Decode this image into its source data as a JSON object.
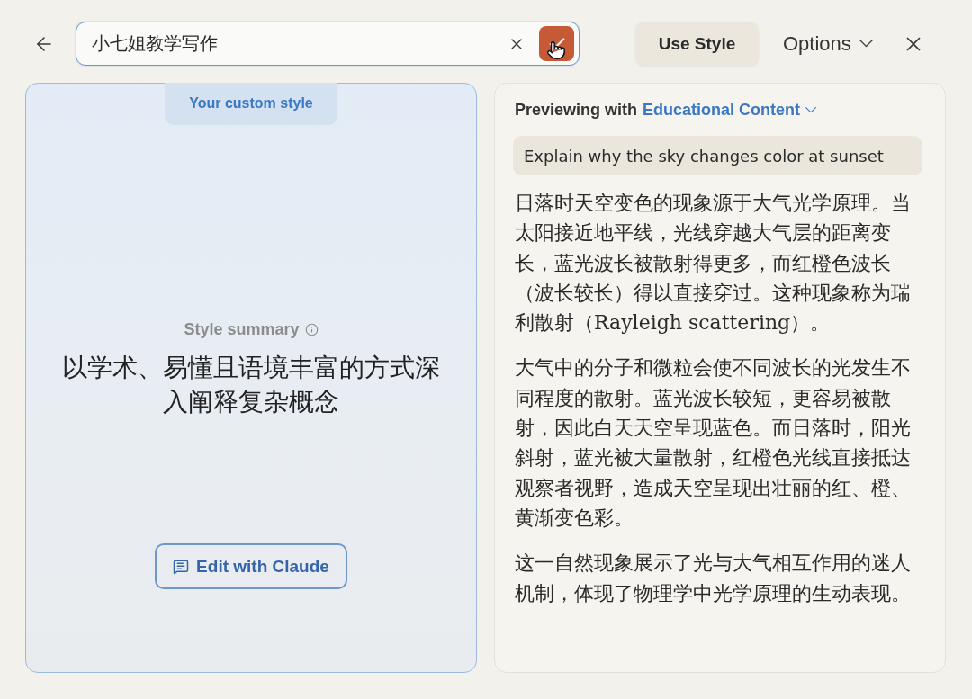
{
  "top_bar": {
    "style_name_field": {
      "value": "小七姐教学写作",
      "focused": true
    },
    "use_style_button": "Use Style",
    "options_menu": "Options"
  },
  "custom_style_panel": {
    "selected": true,
    "tab_label": "Your custom style",
    "summary_label": "Style summary",
    "summary": "以学术、易懂且语境丰富的方式深入阐释复杂概念",
    "edit_button": "Edit with Claude"
  },
  "preview_panel": {
    "heading": "Previewing with",
    "style_menu": "Educational Content",
    "prompt": "Explain why the sky changes color at sunset",
    "paragraphs": [
      "日落时天空变色的现象源于大气光学原理。当太阳接近地平线，光线穿越大气层的距离变长，蓝光波长被散射得更多，而红橙色波长（波长较长）得以直接穿过。这种现象称为瑞利散射（Rayleigh scattering）。",
      "大气中的分子和微粒会使不同波长的光发生不同程度的散射。蓝光波长较短，更容易被散射，因此白天天空呈现蓝色。而日落时，阳光斜射，蓝光被大量散射，红橙色光线直接抵达观察者视野，造成天空呈现出壮丽的红、橙、黄渐变色彩。",
      "这一自然现象展示了光与大气相互作用的迷人机制，体现了物理学中光学原理的生动表现。"
    ]
  }
}
